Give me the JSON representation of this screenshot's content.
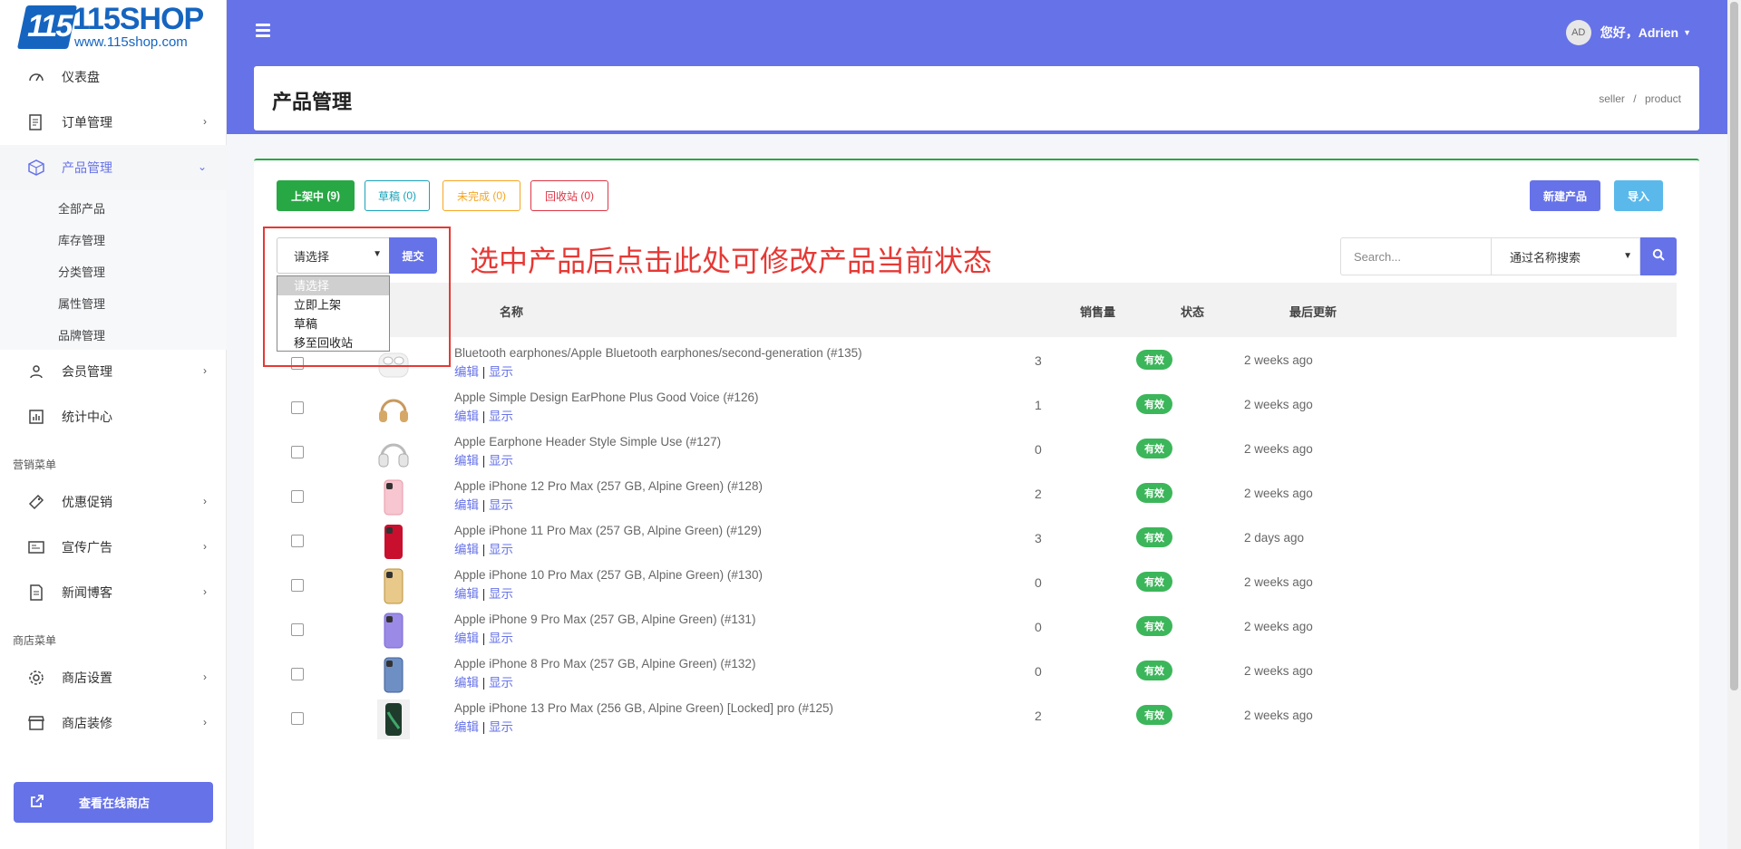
{
  "brand": {
    "logo_mark": "115",
    "name": "115SHOP",
    "url": "www.115shop.com"
  },
  "sidebar": {
    "items": [
      {
        "label": "仪表盘",
        "icon": "dashboard-icon"
      },
      {
        "label": "订单管理",
        "icon": "order-icon"
      },
      {
        "label": "产品管理",
        "icon": "product-icon"
      },
      {
        "label": "会员管理",
        "icon": "users-icon"
      },
      {
        "label": "统计中心",
        "icon": "stats-icon"
      },
      {
        "label": "优惠促销",
        "icon": "promo-icon"
      },
      {
        "label": "宣传广告",
        "icon": "ads-icon"
      },
      {
        "label": "新闻博客",
        "icon": "news-icon"
      },
      {
        "label": "商店设置",
        "icon": "gear-icon"
      },
      {
        "label": "商店装修",
        "icon": "store-icon"
      }
    ],
    "sub_items": [
      "全部产品",
      "库存管理",
      "分类管理",
      "属性管理",
      "品牌管理"
    ],
    "sections": [
      "营销菜单",
      "商店菜单"
    ],
    "online_store_button": "查看在线商店"
  },
  "header": {
    "greeting": "您好，",
    "user_name": "Adrien",
    "avatar_initials": "AD"
  },
  "page": {
    "title": "产品管理",
    "breadcrumb": [
      "seller",
      "/",
      "product"
    ]
  },
  "tabs": [
    {
      "label": "上架中",
      "count": "(9)"
    },
    {
      "label": "草稿",
      "count": "(0)"
    },
    {
      "label": "未完成",
      "count": "(0)"
    },
    {
      "label": "回收站",
      "count": "(0)"
    }
  ],
  "actions": {
    "new_product": "新建产品",
    "import": "导入",
    "submit": "提交"
  },
  "status_select": {
    "value": "请选择",
    "options": [
      "请选择",
      "立即上架",
      "草稿",
      "移至回收站"
    ]
  },
  "annotation": "选中产品后点击此处可修改产品当前状态",
  "search": {
    "placeholder": "Search...",
    "mode": "通过名称搜索"
  },
  "table": {
    "headers": {
      "name": "名称",
      "sales": "销售量",
      "status": "状态",
      "updated": "最后更新"
    },
    "edit_label": "编辑",
    "show_label": "显示",
    "rows": [
      {
        "name": "Bluetooth earphones/Apple Bluetooth earphones/second-generation (#135)",
        "sales": "3",
        "status": "有效",
        "updated": "2 weeks ago",
        "thumb": "airpods"
      },
      {
        "name": "Apple Simple Design EarPhone Plus Good Voice (#126)",
        "sales": "1",
        "status": "有效",
        "updated": "2 weeks ago",
        "thumb": "headphone-gold"
      },
      {
        "name": "Apple Earphone Header Style Simple Use (#127)",
        "sales": "0",
        "status": "有效",
        "updated": "2 weeks ago",
        "thumb": "headphone-silver"
      },
      {
        "name": "Apple iPhone 12 Pro Max (257 GB, Alpine Green) (#128)",
        "sales": "2",
        "status": "有效",
        "updated": "2 weeks ago",
        "thumb": "phone-pink"
      },
      {
        "name": "Apple iPhone 11 Pro Max (257 GB, Alpine Green) (#129)",
        "sales": "3",
        "status": "有效",
        "updated": "2 days ago",
        "thumb": "phone-red"
      },
      {
        "name": "Apple iPhone 10 Pro Max (257 GB, Alpine Green) (#130)",
        "sales": "0",
        "status": "有效",
        "updated": "2 weeks ago",
        "thumb": "phone-gold"
      },
      {
        "name": "Apple iPhone 9 Pro Max (257 GB, Alpine Green) (#131)",
        "sales": "0",
        "status": "有效",
        "updated": "2 weeks ago",
        "thumb": "phone-purple"
      },
      {
        "name": "Apple iPhone 8 Pro Max (257 GB, Alpine Green) (#132)",
        "sales": "0",
        "status": "有效",
        "updated": "2 weeks ago",
        "thumb": "phone-blue"
      },
      {
        "name": "Apple iPhone 13 Pro Max (256 GB, Alpine Green) [Locked] pro (#125)",
        "sales": "2",
        "status": "有效",
        "updated": "2 weeks ago",
        "thumb": "phone-green"
      }
    ]
  },
  "colors": {
    "primary": "#6672e8",
    "success": "#3cb65a",
    "danger": "#e53935",
    "warning": "#f5a623",
    "info": "#17a2b8"
  }
}
